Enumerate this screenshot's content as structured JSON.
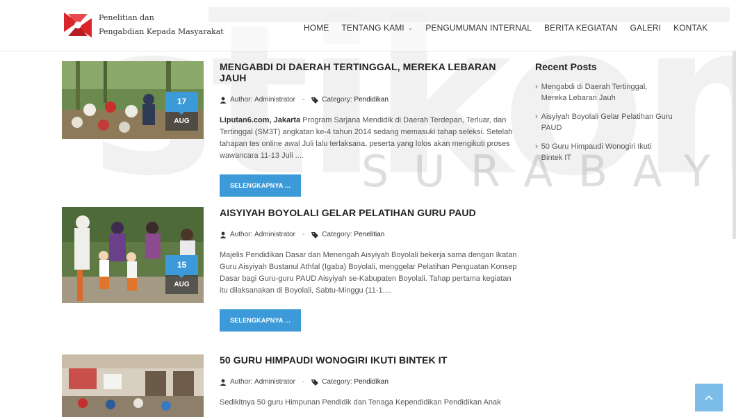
{
  "watermark": {
    "main": "stikom",
    "sub": "SURABAYA"
  },
  "logo": {
    "line1": "Penelitian dan",
    "line2": "Pengabdian Kepada Masyarakat"
  },
  "nav": [
    {
      "label": "HOME",
      "has_dropdown": false
    },
    {
      "label": "TENTANG KAMI",
      "has_dropdown": true
    },
    {
      "label": "PENGUMUMAN INTERNAL",
      "has_dropdown": false
    },
    {
      "label": "BERITA KEGIATAN",
      "has_dropdown": false
    },
    {
      "label": "GALERI",
      "has_dropdown": false
    },
    {
      "label": "KONTAK",
      "has_dropdown": false
    }
  ],
  "posts": [
    {
      "title": "MENGABDI DI DAERAH TERTINGGAL, MEREKA LEBARAN JAUH",
      "day": "17",
      "month": "AUG",
      "author_label": "Author:",
      "author": "Administrator",
      "category_label": "Category:",
      "category": "Pendidikan",
      "excerpt_lead": "Liputan6.com, Jakarta",
      "excerpt": "Program Sarjana Mendidik di Daerah Terdepan, Terluar, dan Tertinggal (SM3T) angkatan ke-4 tahun 2014 sedang memasuki tahap seleksi. Setelah tahapan tes online awal Juli lalu terlaksana, peserta yang lolos akan mengikuti proses wawancara 11-13 Juli ....",
      "button": "SELENGKAPNYA ..."
    },
    {
      "title": "AISYIYAH BOYOLALI GELAR PELATIHAN GURU PAUD",
      "day": "15",
      "month": "AUG",
      "author_label": "Author:",
      "author": "Administrator",
      "category_label": "Category:",
      "category": "Penelitian",
      "excerpt_lead": "",
      "excerpt": "Majelis Pendidikan Dasar dan Menengah Aisyiyah Boyolali bekerja sama dengan Ikatan Guru Aisyiyah Bustanul Athfal (Igaba) Boyolali, menggelar Pelatihan Penguatan Konsep Dasar bagi Guru-guru PAUD Aisyiyah se-Kabupaten Boyolali. Tahap pertama kegiatan itu dilaksanakan di Boyolali, Sabtu-Minggu (11-1....",
      "button": "SELENGKAPNYA ..."
    },
    {
      "title": "50 GURU HIMPAUDI WONOGIRI IKUTI BINTEK IT",
      "author_label": "Author:",
      "author": "Administrator",
      "category_label": "Category:",
      "category": "Pendidikan",
      "excerpt_lead": "",
      "excerpt": "Sedikitnya 50 guru Himpunan Pendidik dan Tenaga Kependidikan Pendidikan Anak"
    }
  ],
  "sidebar": {
    "title": "Recent Posts",
    "items": [
      "Mengabdi di Daerah Tertinggal, Mereka Lebaran Jauh",
      "Aisyiyah Boyolali Gelar Pelatihan Guru PAUD",
      "50 Guru Himpaudi Wonogiri Ikuti Bintek IT"
    ]
  },
  "colors": {
    "accent": "#3d9ad8",
    "scroll_top": "#7bbde8"
  },
  "icons": {
    "author": "user-icon",
    "category": "tag-icon",
    "scroll_top": "chevron-up-icon"
  }
}
